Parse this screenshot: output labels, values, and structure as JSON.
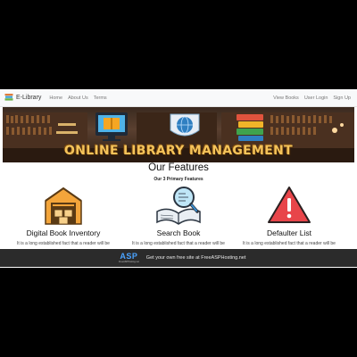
{
  "navbar": {
    "brand": "E-Library",
    "left_links": [
      "Home",
      "About Us",
      "Terms"
    ],
    "right_links": [
      "View Books",
      "User Login",
      "Sign Up"
    ]
  },
  "hero": {
    "title": "ONLINE LIBRARY MANAGEMENT"
  },
  "features": {
    "title": "Our Features",
    "subtitle": "Our 3 Primary Features",
    "cards": [
      {
        "icon": "warehouse-box-icon",
        "title": "Digital Book Inventory",
        "text": "It is a long established fact that a reader will be"
      },
      {
        "icon": "book-search-icon",
        "title": "Search Book",
        "text": "It is a long established fact that a reader will be"
      },
      {
        "icon": "warning-icon",
        "title": "Defaulter List",
        "text": "It is a long established fact that a reader will be"
      }
    ]
  },
  "banner": {
    "logo": "ASP",
    "logo_sub": "FreeASPHosting.net",
    "text": "Get your own free site at FreeASPHosting.net"
  },
  "colors": {
    "accent_gold": "#f4c35a",
    "warning_red": "#e8454a",
    "banner_bg": "#2b2b2b"
  }
}
